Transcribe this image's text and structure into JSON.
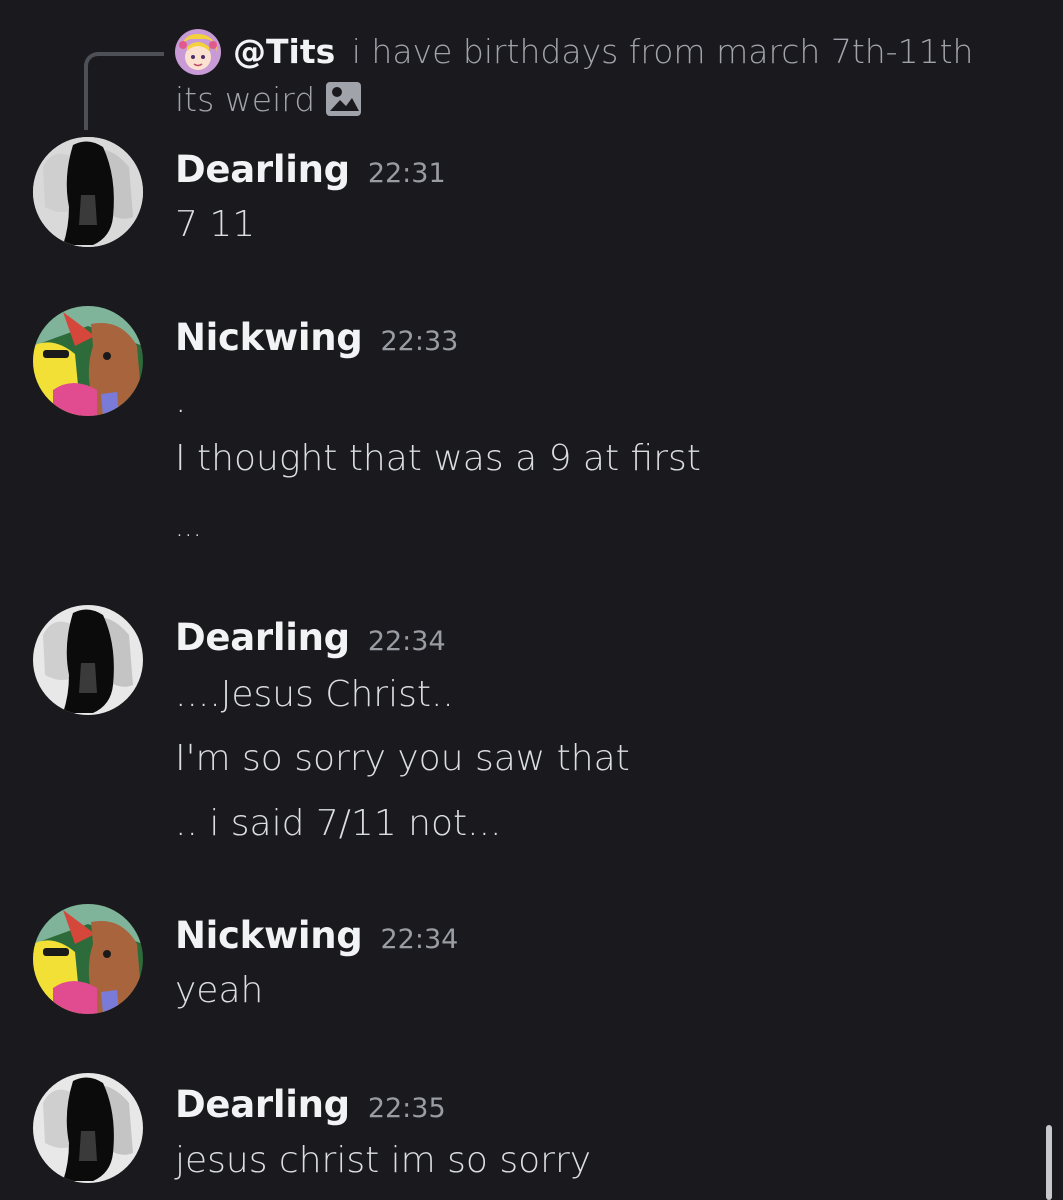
{
  "reply": {
    "username": "@Tits",
    "text": "i have birthdays from march 7th-11th its weird",
    "attachment_icon": "image-icon"
  },
  "messages": [
    {
      "username": "Dearling",
      "timestamp": "22:31",
      "avatar_icon": "dark-hair-figure-avatar",
      "lines": [
        "7 11"
      ]
    },
    {
      "username": "Nickwing",
      "timestamp": "22:33",
      "avatar_icon": "cartoon-characters-avatar",
      "lines": [
        ".",
        "I thought that was a 9 at first",
        "..."
      ]
    },
    {
      "username": "Dearling",
      "timestamp": "22:34",
      "avatar_icon": "dark-hair-figure-avatar",
      "lines": [
        "....Jesus Christ..",
        "I'm so sorry you saw that",
        ".. i said 7/11 not..."
      ]
    },
    {
      "username": "Nickwing",
      "timestamp": "22:34",
      "avatar_icon": "cartoon-characters-avatar",
      "lines": [
        "yeah"
      ]
    },
    {
      "username": "Dearling",
      "timestamp": "22:35",
      "avatar_icon": "dark-hair-figure-avatar",
      "lines": [
        "jesus christ im so sorry"
      ]
    }
  ],
  "colors": {
    "background": "#1a1a1e",
    "username": "#f2f3f5",
    "text": "#dbdee1",
    "timestamp": "#9a9ca3",
    "reply_line": "#4e5058"
  }
}
